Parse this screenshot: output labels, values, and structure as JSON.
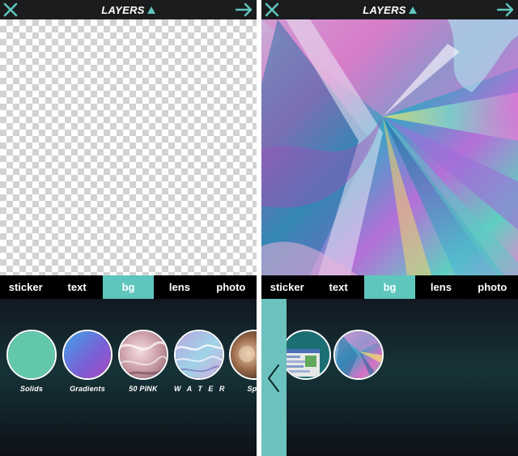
{
  "colors": {
    "accent": "#5ec6bd",
    "topbar": "#1b1c1e",
    "tabbar": "#000000",
    "drawer": "#6cc2be"
  },
  "icons": {
    "close": "close-icon",
    "next": "arrow-right-icon",
    "caret": "caret-up-icon",
    "drawer": "chevron-left-icon"
  },
  "left_panel": {
    "topbar": {
      "title": "LAYERS"
    },
    "canvas": {
      "state": "transparent"
    },
    "tabs": [
      {
        "label": "sticker",
        "active": false
      },
      {
        "label": "text",
        "active": false
      },
      {
        "label": "bg",
        "active": true
      },
      {
        "label": "lens",
        "active": false
      },
      {
        "label": "photo",
        "active": false
      }
    ],
    "bg_items": [
      {
        "label": "Solids"
      },
      {
        "label": "Gradients"
      },
      {
        "label": "50 PINK"
      },
      {
        "label": "W A T E R"
      },
      {
        "label": "Spa"
      }
    ]
  },
  "right_panel": {
    "topbar": {
      "title": "LAYERS"
    },
    "canvas": {
      "state": "holographic background"
    },
    "tabs": [
      {
        "label": "sticker",
        "active": false
      },
      {
        "label": "text",
        "active": false
      },
      {
        "label": "bg",
        "active": true
      },
      {
        "label": "lens",
        "active": false
      },
      {
        "label": "photo",
        "active": false
      }
    ]
  }
}
